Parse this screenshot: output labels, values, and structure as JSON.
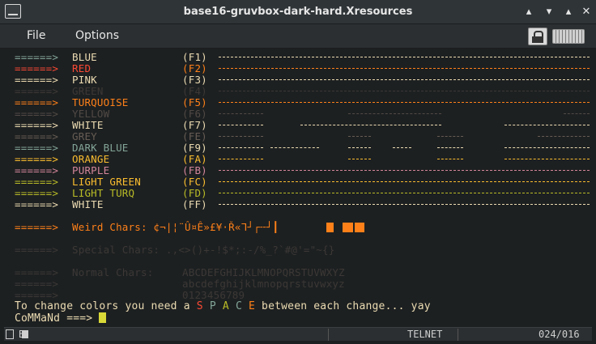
{
  "window": {
    "title": "base16-gruvbox-dark-hard.Xresources"
  },
  "menu": [
    "File",
    "Options"
  ],
  "icons": {
    "app": "terminal-icon",
    "lock": "lock-icon",
    "keyboard": "keyboard-icon"
  },
  "color_rows": [
    {
      "arrow": "======>",
      "name": "BLUE",
      "key": "(F1)",
      "arrow_color": "#83a598",
      "name_color": "#ebdbb2",
      "key_color": "#ebdbb2",
      "dash_color": "#ebdbb2",
      "dash_style": "solid"
    },
    {
      "arrow": "======>",
      "name": "RED",
      "key": "(F2)",
      "arrow_color": "#fb4934",
      "name_color": "#fb4934",
      "key_color": "#fe8019",
      "dash_color": "#fe8019",
      "dash_style": "solid"
    },
    {
      "arrow": "======>",
      "name": "PINK",
      "key": "(F3)",
      "arrow_color": "#ebdbb2",
      "name_color": "#ebdbb2",
      "key_color": "#ebdbb2",
      "dash_color": "#ebdbb2",
      "dash_style": "solid"
    },
    {
      "arrow": "======>",
      "name": "GREEN",
      "key": "(F4)",
      "arrow_color": "#3c3836",
      "name_color": "#3c3836",
      "key_color": "#3c3836",
      "dash_color": "#3c3836",
      "dash_style": "solid"
    },
    {
      "arrow": "======>",
      "name": "TURQUOISE",
      "key": "(F5)",
      "arrow_color": "#fe8019",
      "name_color": "#fe8019",
      "key_color": "#fe8019",
      "dash_color": "#fe8019",
      "dash_style": "solid"
    },
    {
      "arrow": "======>",
      "name": "YELLOW",
      "key": "(F6)",
      "arrow_color": "#504945",
      "name_color": "#504945",
      "key_color": "#504945",
      "dash_color": "#504945",
      "dash_style": "gaps1"
    },
    {
      "arrow": "======>",
      "name": "WHITE",
      "key": "(F7)",
      "arrow_color": "#ebdbb2",
      "name_color": "#ebdbb2",
      "key_color": "#ebdbb2",
      "dash_color": "#ebdbb2",
      "dash_style": "gaps2"
    },
    {
      "arrow": "======>",
      "name": "GREY",
      "key": "(FE)",
      "arrow_color": "#665c54",
      "name_color": "#665c54",
      "key_color": "#665c54",
      "dash_color": "#665c54",
      "dash_style": "gaps3"
    },
    {
      "arrow": "======>",
      "name": "DARK BLUE",
      "key": "(F9)",
      "arrow_color": "#83a598",
      "name_color": "#83a598",
      "key_color": "#ebdbb2",
      "dash_color": "#ebdbb2",
      "dash_style": "gaps4"
    },
    {
      "arrow": "======>",
      "name": "ORANGE",
      "key": "(FA)",
      "arrow_color": "#fabd2f",
      "name_color": "#fabd2f",
      "key_color": "#fabd2f",
      "dash_color": "#fabd2f",
      "dash_style": "gaps5"
    },
    {
      "arrow": "======>",
      "name": "PURPLE",
      "key": "(FB)",
      "arrow_color": "#d3869b",
      "name_color": "#d3869b",
      "key_color": "#d3869b",
      "dash_color": "#d3869b",
      "dash_style": "solid"
    },
    {
      "arrow": "======>",
      "name": "LIGHT GREEN",
      "key": "(FC)",
      "arrow_color": "#b8bb26",
      "name_color": "#fabd2f",
      "key_color": "#fabd2f",
      "dash_color": "#fabd2f",
      "dash_style": "solid"
    },
    {
      "arrow": "======>",
      "name": "LIGHT TURQ",
      "key": "(FD)",
      "arrow_color": "#b8bb26",
      "name_color": "#b8bb26",
      "key_color": "#b8bb26",
      "dash_color": "#b8bb26",
      "dash_style": "solid"
    },
    {
      "arrow": "======>",
      "name": "WHITE",
      "key": "(FF)",
      "arrow_color": "#ebdbb2",
      "name_color": "#ebdbb2",
      "key_color": "#ebdbb2",
      "dash_color": "#ebdbb2",
      "dash_style": "solid"
    }
  ],
  "weird_line": {
    "arrow": "======>",
    "text": "Weird Chars: ¢¬|¦¨Û¤Ê»£¥·Ř«ᒣ┘┌╌┘┃",
    "color": "#fe8019"
  },
  "special_line": {
    "arrow": "======>",
    "text": "Special Chars: .,<>()+-!$*;:-/%_?`#@'=\"~{}",
    "color": "#3c3836"
  },
  "normal_lines": [
    {
      "arrow": "======>",
      "label": "Normal Chars:",
      "text": "ABCDEFGHIJKLMNOPQRSTUVWXYZ"
    },
    {
      "arrow": "======>",
      "label": "",
      "text": "abcdefghijklmnopqrstuvwxyz"
    },
    {
      "arrow": "======>",
      "label": "",
      "text": "0123456789"
    }
  ],
  "normal_color": "#3c3836",
  "info_line": {
    "prefix": "To change colors you need a ",
    "letters": [
      {
        "ch": "S",
        "color": "#fb4934"
      },
      {
        "ch": "P",
        "color": "#83a598"
      },
      {
        "ch": "A",
        "color": "#b8bb26"
      },
      {
        "ch": "C",
        "color": "#83a598"
      },
      {
        "ch": "E",
        "color": "#fe8019"
      }
    ],
    "suffix": " between each change... yay",
    "color": "#ebdbb2"
  },
  "command_line": {
    "prompt": "CoMMaNd ===> ",
    "color": "#ebdbb2"
  },
  "status": {
    "protocol": "TELNET",
    "position": "024/016",
    "indicator": "B"
  }
}
